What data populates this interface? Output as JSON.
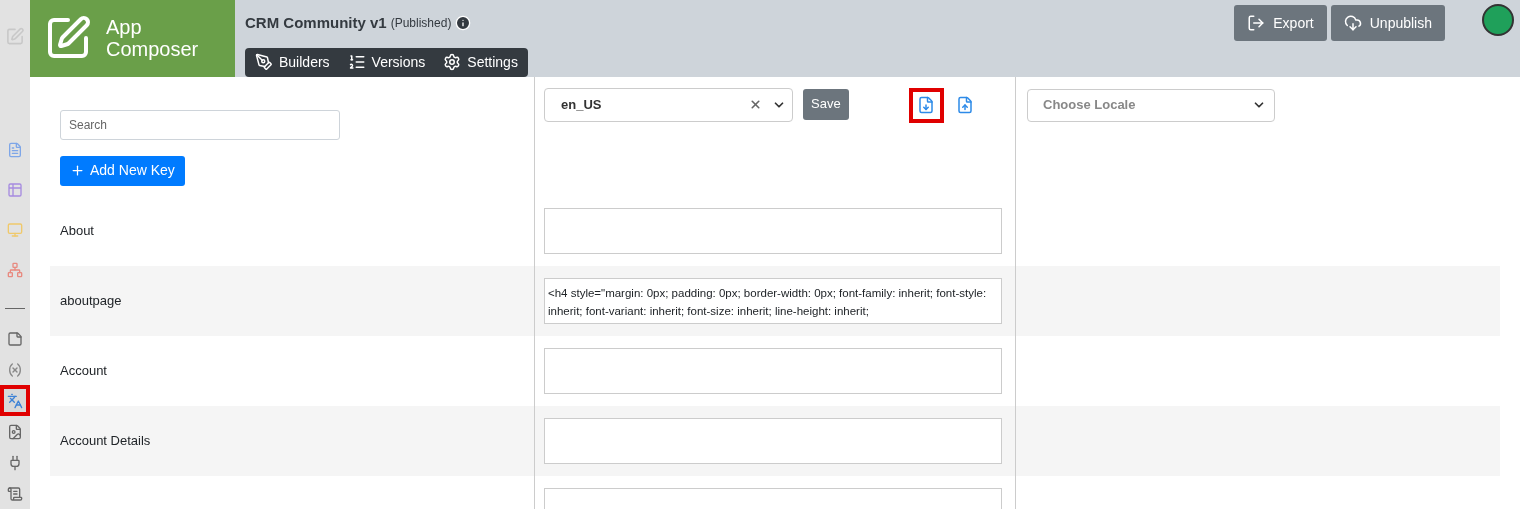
{
  "header": {
    "app_name": "App Composer",
    "title": "CRM Community v1",
    "status": "(Published)",
    "nav": [
      {
        "label": "Builders"
      },
      {
        "label": "Versions"
      },
      {
        "label": "Settings"
      }
    ],
    "actions": [
      {
        "label": "Export"
      },
      {
        "label": "Unpublish"
      }
    ]
  },
  "sidebar": {
    "items": [
      {
        "selected": false
      },
      {
        "selected": false
      },
      {
        "selected": false
      },
      {
        "selected": false
      },
      {
        "selected": false
      },
      {
        "selected": false
      },
      {
        "selected": true
      },
      {
        "selected": false
      },
      {
        "selected": false
      },
      {
        "selected": false
      }
    ]
  },
  "search": {
    "placeholder": "Search"
  },
  "add_button": "Add New Key",
  "locale_select": {
    "value": "en_US"
  },
  "save_button": "Save",
  "file_actions": [
    {
      "highlighted": true
    },
    {
      "highlighted": false
    }
  ],
  "compare_select": {
    "placeholder": "Choose Locale"
  },
  "rows": [
    {
      "key": "About",
      "value": ""
    },
    {
      "key": "aboutpage",
      "value": "<h4 style=\"margin: 0px; padding: 0px; border-width: 0px; font-family: inherit; font-style: inherit; font-variant: inherit; font-size: inherit; line-height: inherit;"
    },
    {
      "key": "Account",
      "value": ""
    },
    {
      "key": "Account Details",
      "value": ""
    },
    {
      "key": "",
      "value": ""
    }
  ]
}
